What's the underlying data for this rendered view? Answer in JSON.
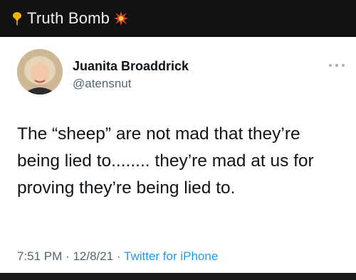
{
  "header": {
    "title": "Truth Bomb",
    "pin_icon": "pin-icon",
    "spark_icon": "explosion-icon",
    "accent_color": "#e8402a"
  },
  "tweet": {
    "author_name": "Juanita Broaddrick",
    "author_handle": "@atensnut",
    "more_icon": "ellipsis-icon",
    "text": "The “sheep” are not mad that they’re being lied to........ they’re mad at us for proving they’re being lied to.",
    "time": "7:51 PM",
    "separator": "·",
    "date": "12/8/21",
    "source": "Twitter for iPhone",
    "source_color": "#1d9bf0"
  }
}
